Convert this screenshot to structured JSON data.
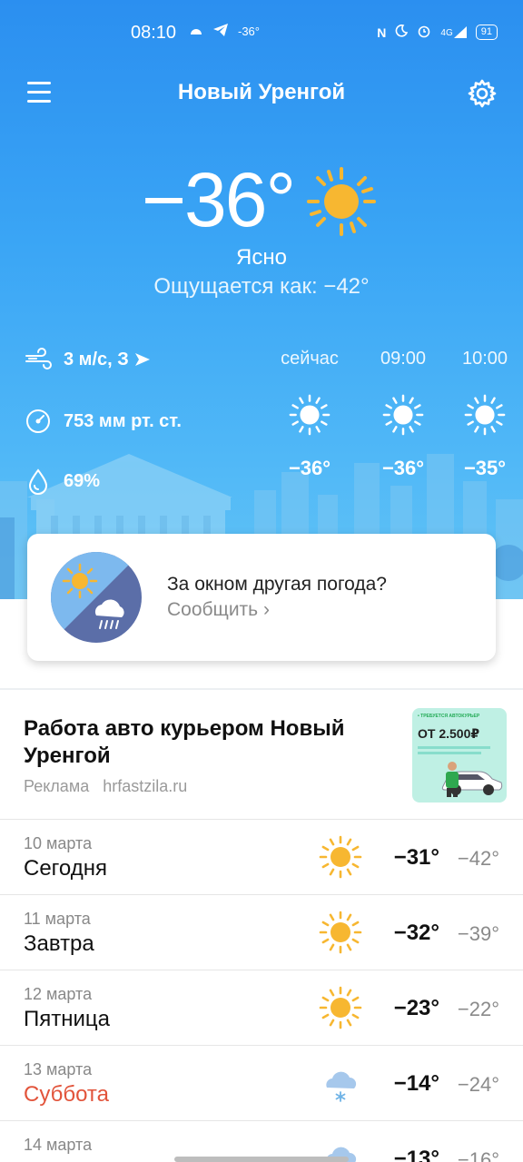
{
  "status_bar": {
    "time": "08:10",
    "notification_temp": "-36°",
    "battery": "91",
    "network": "4G"
  },
  "header": {
    "city": "Новый Уренгой"
  },
  "current": {
    "temperature": "−36°",
    "condition": "Ясно",
    "feels_like": "Ощущается как: −42°",
    "icon": "sun-icon"
  },
  "params": {
    "wind": "3 м/с, З",
    "pressure": "753 мм рт. ст.",
    "humidity": "69%"
  },
  "hourly": [
    {
      "label": "сейчас",
      "temp": "−36°",
      "icon": "sun-icon"
    },
    {
      "label": "09:00",
      "temp": "−36°",
      "icon": "sun-icon"
    },
    {
      "label": "10:00",
      "temp": "−35°",
      "icon": "sun-icon"
    }
  ],
  "report": {
    "title": "За окном другая погода?",
    "link": "Сообщить  ›"
  },
  "ad": {
    "title": "Работа авто курьером Новый Уренгой",
    "label": "Реклама",
    "domain": "hrfastzila.ru",
    "image_text_top": "• ТРЕБУЕТСЯ АВТОКУРЬЕР",
    "image_text_price": "ОТ 2.500₽"
  },
  "forecast": [
    {
      "date": "10 марта",
      "day": "Сегодня",
      "max": "−31°",
      "min": "−42°",
      "icon": "sun-icon",
      "weekend": false
    },
    {
      "date": "11 марта",
      "day": "Завтра",
      "max": "−32°",
      "min": "−39°",
      "icon": "sun-icon",
      "weekend": false
    },
    {
      "date": "12 марта",
      "day": "Пятница",
      "max": "−23°",
      "min": "−22°",
      "icon": "sun-icon",
      "weekend": false
    },
    {
      "date": "13 марта",
      "day": "Суббота",
      "max": "−14°",
      "min": "−24°",
      "icon": "snow-cloud-icon",
      "weekend": true
    },
    {
      "date": "14 марта",
      "day": "",
      "max": "−13°",
      "min": "−16°",
      "icon": "cloud-icon",
      "weekend": false
    }
  ],
  "colors": {
    "sky_top": "#2b8ff0",
    "sky_bottom": "#62c4f6",
    "sun": "#f7b731",
    "weekend": "#e2543b"
  }
}
